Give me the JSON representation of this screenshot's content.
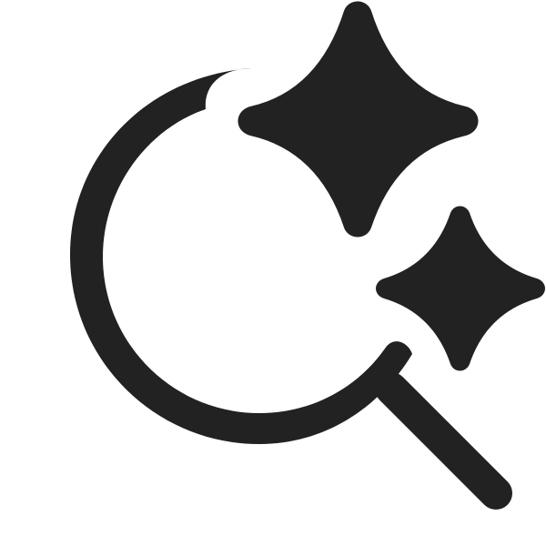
{
  "icon": {
    "name": "search-sparkle-icon",
    "color": "#222222",
    "background": "#ffffff"
  }
}
